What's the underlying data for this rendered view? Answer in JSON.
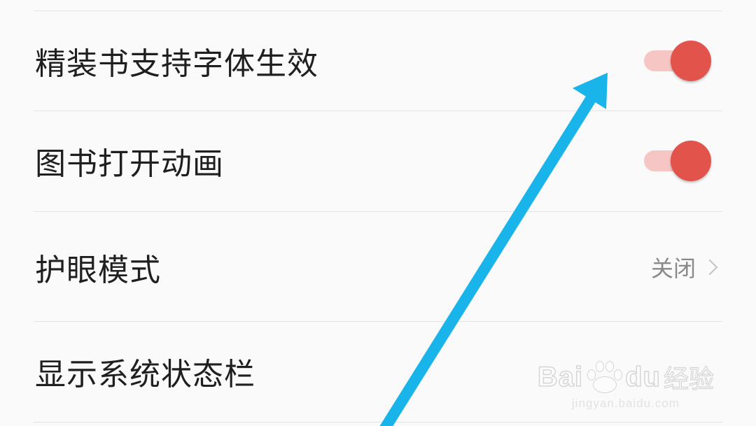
{
  "settings": {
    "items": [
      {
        "label": "精装书支持字体生效",
        "control": "toggle",
        "on": true
      },
      {
        "label": "图书打开动画",
        "control": "toggle",
        "on": true
      },
      {
        "label": "护眼模式",
        "control": "value",
        "value": "关闭"
      },
      {
        "label": "显示系统状态栏",
        "control": "toggle",
        "on": false
      }
    ]
  },
  "colors": {
    "toggle_on_thumb": "#e2534b",
    "toggle_on_track": "#f6c6c4",
    "annotation_arrow": "#18b4ea",
    "background": "#fafafa"
  },
  "annotation": {
    "type": "arrow",
    "icon": "annotation-arrow-icon"
  },
  "watermark": {
    "brand_latin_1": "Bai",
    "brand_latin_2": "du",
    "brand_cn": "经验",
    "url": "jingyan.baidu.com"
  }
}
